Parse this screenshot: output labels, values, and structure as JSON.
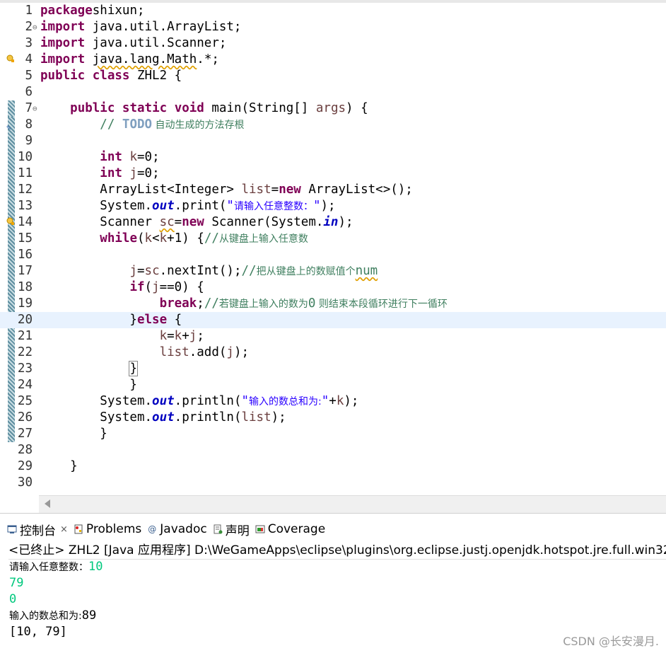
{
  "editor": {
    "lines": [
      {
        "n": "1",
        "t": [
          [
            "kw",
            "package"
          ],
          [
            "",
            "shixun;"
          ]
        ]
      },
      {
        "n": "2",
        "t": [
          [
            "kw",
            "import"
          ],
          [
            "",
            " java.util.ArrayList;"
          ]
        ]
      },
      {
        "n": "3",
        "t": [
          [
            "kw",
            "import"
          ],
          [
            "",
            " java.util.Scanner;"
          ]
        ]
      },
      {
        "n": "4",
        "t": [
          [
            "kw",
            "import"
          ],
          [
            "",
            " "
          ],
          [
            "warn",
            "java.lang.Math"
          ],
          [
            "",
            ".*;"
          ]
        ]
      },
      {
        "n": "5",
        "t": [
          [
            "kw",
            "public"
          ],
          [
            "",
            " "
          ],
          [
            "kw",
            "class"
          ],
          [
            "",
            " ZHL2 {"
          ]
        ]
      },
      {
        "n": "6",
        "t": []
      },
      {
        "n": "7",
        "t": [
          [
            "",
            "    "
          ],
          [
            "kw",
            "public"
          ],
          [
            "",
            " "
          ],
          [
            "kw",
            "static"
          ],
          [
            "",
            " "
          ],
          [
            "kw",
            "void"
          ],
          [
            "",
            " main(String[] "
          ],
          [
            "var",
            "args"
          ],
          [
            "",
            ") {"
          ]
        ]
      },
      {
        "n": "8",
        "t": [
          [
            "",
            "        "
          ],
          [
            "cmmono",
            "// "
          ],
          [
            "todo",
            "TODO"
          ],
          [
            "cm",
            " 自动生成的方法存根"
          ]
        ]
      },
      {
        "n": "9",
        "t": []
      },
      {
        "n": "10",
        "t": [
          [
            "",
            "        "
          ],
          [
            "kw",
            "int"
          ],
          [
            "",
            " "
          ],
          [
            "var",
            "k"
          ],
          [
            "",
            "=0;"
          ]
        ]
      },
      {
        "n": "11",
        "t": [
          [
            "",
            "        "
          ],
          [
            "kw",
            "int"
          ],
          [
            "",
            " "
          ],
          [
            "var",
            "j"
          ],
          [
            "",
            "=0;"
          ]
        ]
      },
      {
        "n": "12",
        "t": [
          [
            "",
            "        ArrayList<Integer> "
          ],
          [
            "var",
            "list"
          ],
          [
            "",
            "="
          ],
          [
            "kw",
            "new"
          ],
          [
            "",
            " ArrayList<>();"
          ]
        ]
      },
      {
        "n": "13",
        "t": [
          [
            "",
            "        System."
          ],
          [
            "fld",
            "out"
          ],
          [
            "",
            ".print("
          ],
          [
            "st",
            "\""
          ],
          [
            "stcn",
            "请输入任意整数："
          ],
          [
            "st",
            "\""
          ],
          [
            "",
            ");"
          ]
        ]
      },
      {
        "n": "14",
        "t": [
          [
            "",
            "        Scanner "
          ],
          [
            "var warn",
            "sc"
          ],
          [
            "",
            "="
          ],
          [
            "kw",
            "new"
          ],
          [
            "",
            " Scanner(System."
          ],
          [
            "fld",
            "in"
          ],
          [
            "",
            ");"
          ]
        ]
      },
      {
        "n": "15",
        "t": [
          [
            "",
            "        "
          ],
          [
            "kw",
            "while"
          ],
          [
            "",
            "("
          ],
          [
            "var",
            "k"
          ],
          [
            "",
            "<"
          ],
          [
            "var",
            "k"
          ],
          [
            "",
            "+1) {"
          ],
          [
            "cmmono",
            "//"
          ],
          [
            "cm",
            "从键盘上输入任意数"
          ]
        ]
      },
      {
        "n": "16",
        "t": []
      },
      {
        "n": "17",
        "t": [
          [
            "",
            "            "
          ],
          [
            "var",
            "j"
          ],
          [
            "",
            "="
          ],
          [
            "var",
            "sc"
          ],
          [
            "",
            ".nextInt();"
          ],
          [
            "cmmono",
            "//"
          ],
          [
            "cm",
            "把从键盘上的数赋值个"
          ],
          [
            "cmmono warn",
            "num"
          ]
        ]
      },
      {
        "n": "18",
        "t": [
          [
            "",
            "            "
          ],
          [
            "kw",
            "if"
          ],
          [
            "",
            "("
          ],
          [
            "var",
            "j"
          ],
          [
            "",
            "==0) {"
          ]
        ]
      },
      {
        "n": "19",
        "t": [
          [
            "",
            "                "
          ],
          [
            "kw",
            "break"
          ],
          [
            "",
            ";"
          ],
          [
            "cmmono",
            "//"
          ],
          [
            "cm",
            "若键盘上输入的数为"
          ],
          [
            "cmmono",
            "0"
          ],
          [
            "cm",
            " 则结束本段循环进行下一循环"
          ]
        ]
      },
      {
        "n": "20",
        "t": [
          [
            "",
            "            }"
          ],
          [
            "kw",
            "else"
          ],
          [
            "",
            " {"
          ]
        ]
      },
      {
        "n": "21",
        "t": [
          [
            "",
            "                "
          ],
          [
            "var",
            "k"
          ],
          [
            "",
            "="
          ],
          [
            "var",
            "k"
          ],
          [
            "",
            "+"
          ],
          [
            "var",
            "j"
          ],
          [
            "",
            ";"
          ]
        ]
      },
      {
        "n": "22",
        "t": [
          [
            "",
            "                "
          ],
          [
            "var",
            "list"
          ],
          [
            "",
            ".add("
          ],
          [
            "var",
            "j"
          ],
          [
            "",
            ");"
          ]
        ]
      },
      {
        "n": "23",
        "t": [
          [
            "",
            "            "
          ],
          [
            "bracket-box",
            "}"
          ]
        ]
      },
      {
        "n": "24",
        "t": [
          [
            "",
            "            }"
          ]
        ]
      },
      {
        "n": "25",
        "t": [
          [
            "",
            "        System."
          ],
          [
            "fld",
            "out"
          ],
          [
            "",
            ".println("
          ],
          [
            "st",
            "\""
          ],
          [
            "stcn",
            "输入的数总和为:"
          ],
          [
            "st",
            "\""
          ],
          [
            "",
            "+"
          ],
          [
            "var",
            "k"
          ],
          [
            "",
            ");"
          ]
        ]
      },
      {
        "n": "26",
        "t": [
          [
            "",
            "        System."
          ],
          [
            "fld",
            "out"
          ],
          [
            "",
            ".println("
          ],
          [
            "var",
            "list"
          ],
          [
            "",
            ");"
          ]
        ]
      },
      {
        "n": "27",
        "t": [
          [
            "",
            "        }"
          ]
        ]
      },
      {
        "n": "28",
        "t": []
      },
      {
        "n": "29",
        "t": [
          [
            "",
            "    }"
          ]
        ]
      },
      {
        "n": "30",
        "t": []
      }
    ],
    "folds": {
      "2": "⊖",
      "7": "⊖"
    },
    "current_line": "20"
  },
  "console": {
    "tabs": {
      "console": "控制台",
      "problems": "Problems",
      "javadoc": "Javadoc",
      "declaration": "声明",
      "coverage": "Coverage"
    },
    "close_symbol": "×",
    "terminated": "<已终止> ZHL2 [Java 应用程序] D:\\WeGameApps\\eclipse\\plugins\\org.eclipse.justj.openjdk.hotspot.jre.full.win32",
    "prompt": "请输入任意整数：",
    "input1": "10",
    "input2": "79",
    "input3": "0",
    "sum_label": "输入的数总和为:",
    "sum_value": "89",
    "list_output": "[10, 79]"
  },
  "watermark": "CSDN @长安漫月."
}
